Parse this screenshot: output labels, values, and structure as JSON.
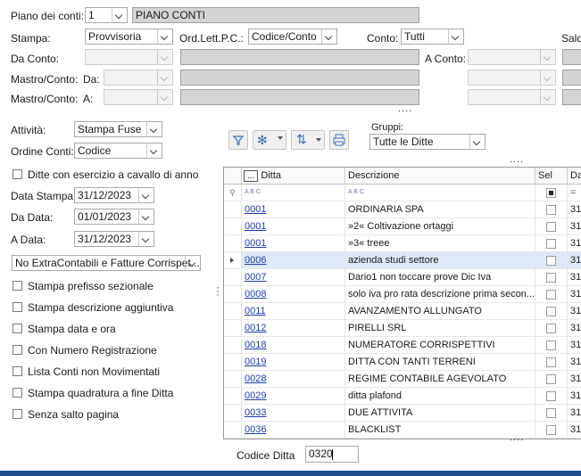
{
  "piano": {
    "label": "Piano dei conti:",
    "number": "1",
    "name": "PIANO CONTI"
  },
  "stampa": {
    "label": "Stampa:",
    "value": "Provvisoria"
  },
  "ord": {
    "label": "Ord.Lett.P.C.:",
    "value": "Codice/Conto"
  },
  "conto": {
    "label": "Conto:",
    "value": "Tutti"
  },
  "saldo_label": "Saldo",
  "da_conto_label": "Da Conto:",
  "a_conto_label": "A Conto:",
  "mastro_da": {
    "label": "Mastro/Conto:",
    "sub": "Da:"
  },
  "mastro_a": {
    "label": "Mastro/Conto:",
    "sub": "A:"
  },
  "dots": "....",
  "attivita": {
    "label": "Attività:",
    "value": "Stampa Fuse"
  },
  "ordine": {
    "label": "Ordine Conti:",
    "value": "Codice"
  },
  "gruppi": {
    "label": "Gruppi:",
    "value": "Tutte le Ditte"
  },
  "ditte_cavallo": "Ditte con esercizio a cavallo di anno",
  "data_stampa": {
    "label": "Data Stampa:",
    "value": "31/12/2023"
  },
  "da_data": {
    "label": "Da Data:",
    "value": "01/01/2023"
  },
  "a_data": {
    "label": "A Data:",
    "value": "31/12/2023"
  },
  "extra": {
    "value": "No ExtraContabili e Fatture Corrispet..."
  },
  "options": [
    "Stampa prefisso sezionale",
    "Stampa descrizione aggiuntiva",
    "Stampa data e ora",
    "Con Numero Registrazione",
    "Lista Conti non Movimentati",
    "Stampa quadratura a fine Ditta",
    "Senza salto pagina"
  ],
  "toolbar": {
    "filter_icon": "filter-icon",
    "snowflake_icon": "snowflake-icon",
    "sort_icon": "sort-icon",
    "print_icon": "print-icon"
  },
  "grid": {
    "headers": {
      "menu": "...",
      "ditta": "Ditta",
      "descrizione": "Descrizione",
      "sel": "Sel",
      "da": "Da"
    },
    "filter_glyph": "A B C",
    "rows": [
      {
        "code": "0001",
        "desc": "ORDINARIA SPA",
        "d": "31"
      },
      {
        "code": "0001",
        "desc": "»2« Coltivazione ortaggi",
        "d": "31"
      },
      {
        "code": "0001",
        "desc": "»3« treee",
        "d": "31"
      },
      {
        "code": "0006",
        "desc": "azienda studi settore",
        "d": "31",
        "current": true
      },
      {
        "code": "0007",
        "desc": "Dario1 non toccare prove Dic Iva",
        "d": "31"
      },
      {
        "code": "0008",
        "desc": "solo iva pro rata descrizione prima secon...",
        "d": "31"
      },
      {
        "code": "0011",
        "desc": "AVANZAMENTO ALLUNGATO",
        "d": "31"
      },
      {
        "code": "0012",
        "desc": "PIRELLI SRL",
        "d": "31"
      },
      {
        "code": "0018",
        "desc": "NUMERATORE CORRISPETTIVI",
        "d": "31"
      },
      {
        "code": "0019",
        "desc": "DITTA CON TANTI TERRENI",
        "d": "31"
      },
      {
        "code": "0028",
        "desc": "REGIME CONTABILE AGEVOLATO",
        "d": "31"
      },
      {
        "code": "0029",
        "desc": "ditta plafond",
        "d": "31"
      },
      {
        "code": "0033",
        "desc": "DUE ATTIVITA",
        "d": "31"
      },
      {
        "code": "0036",
        "desc": "BLACKLIST",
        "d": "31"
      }
    ]
  },
  "codice_ditta": {
    "label": "Codice Ditta",
    "value": "0320"
  }
}
